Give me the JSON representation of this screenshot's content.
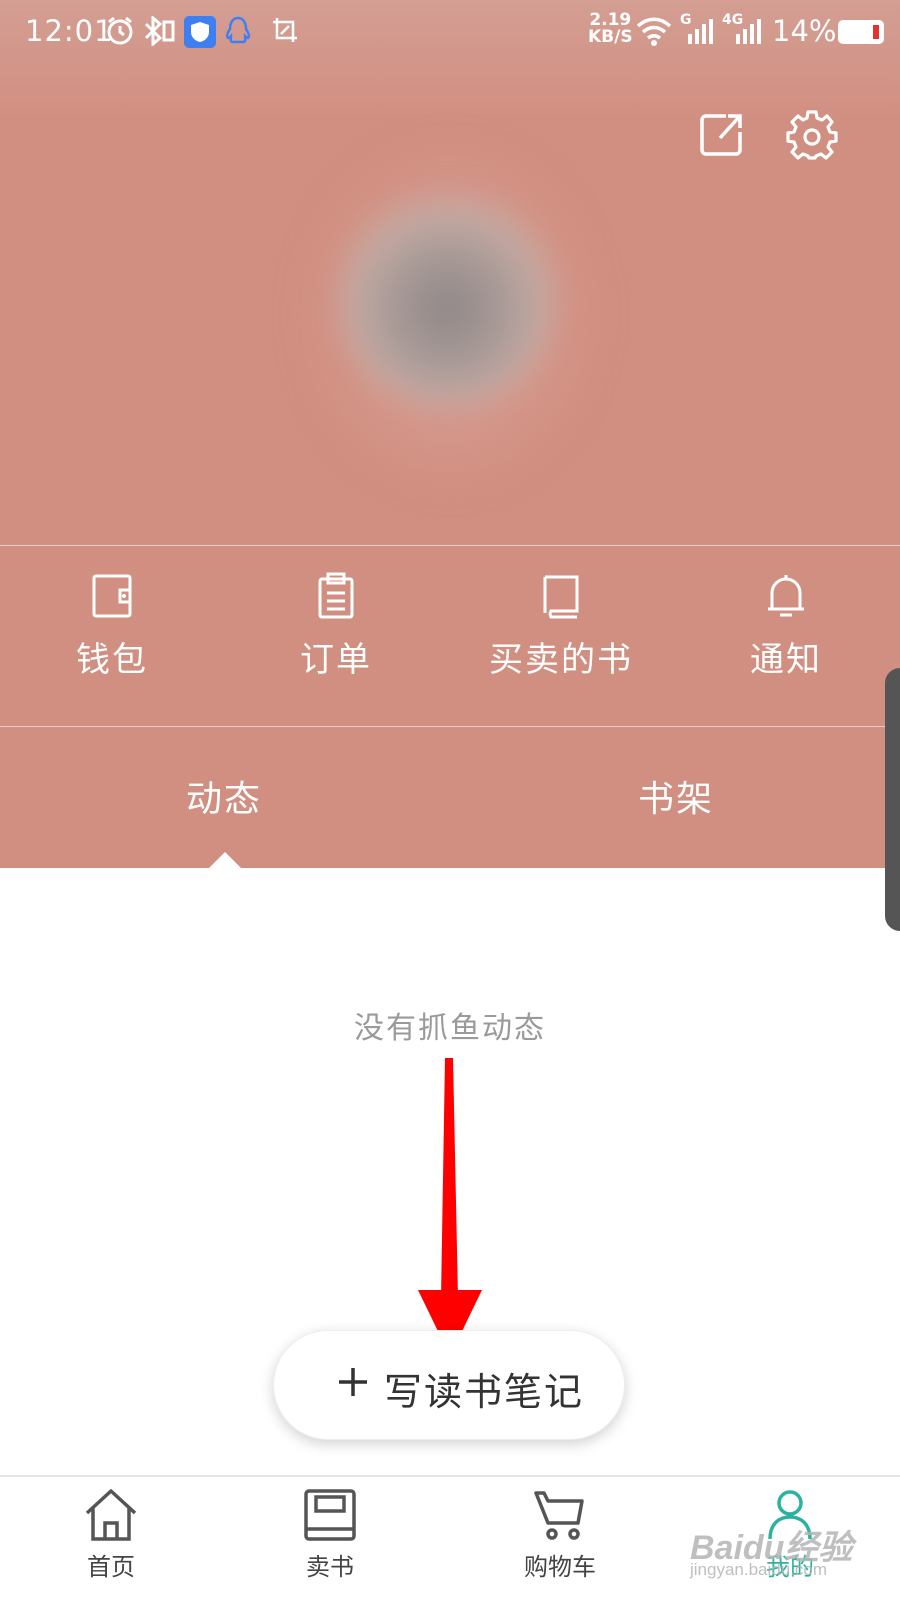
{
  "status_bar": {
    "time": "12:01",
    "net_speed_value": "2.19",
    "net_speed_unit": "KB/S",
    "signal_1_label": "G",
    "signal_2_label": "4G",
    "battery_percent": "14%"
  },
  "profile_actions": {
    "share_icon": "share-icon",
    "settings_icon": "gear-icon"
  },
  "quick_menu": [
    {
      "label": "钱包",
      "icon": "wallet-icon"
    },
    {
      "label": "订单",
      "icon": "clipboard-icon"
    },
    {
      "label": "买卖的书",
      "icon": "book-icon"
    },
    {
      "label": "通知",
      "icon": "bell-icon"
    }
  ],
  "tabs": [
    {
      "label": "动态",
      "active": true
    },
    {
      "label": "书架",
      "active": false
    }
  ],
  "feed": {
    "empty_message": "没有抓鱼动态"
  },
  "write_note_button": {
    "label": "写读书笔记"
  },
  "bottom_nav": [
    {
      "label": "首页",
      "icon": "home-icon",
      "active": false
    },
    {
      "label": "卖书",
      "icon": "sell-book-icon",
      "active": false
    },
    {
      "label": "购物车",
      "icon": "cart-icon",
      "active": false
    },
    {
      "label": "我的",
      "icon": "profile-icon",
      "active": true
    }
  ],
  "watermark": {
    "brand": "Baidu经验",
    "url": "jingyan.baidu.com"
  },
  "colors": {
    "header_bg": "#d18f81",
    "accent": "#2bb3a0",
    "annotation_arrow": "#ff0000"
  }
}
